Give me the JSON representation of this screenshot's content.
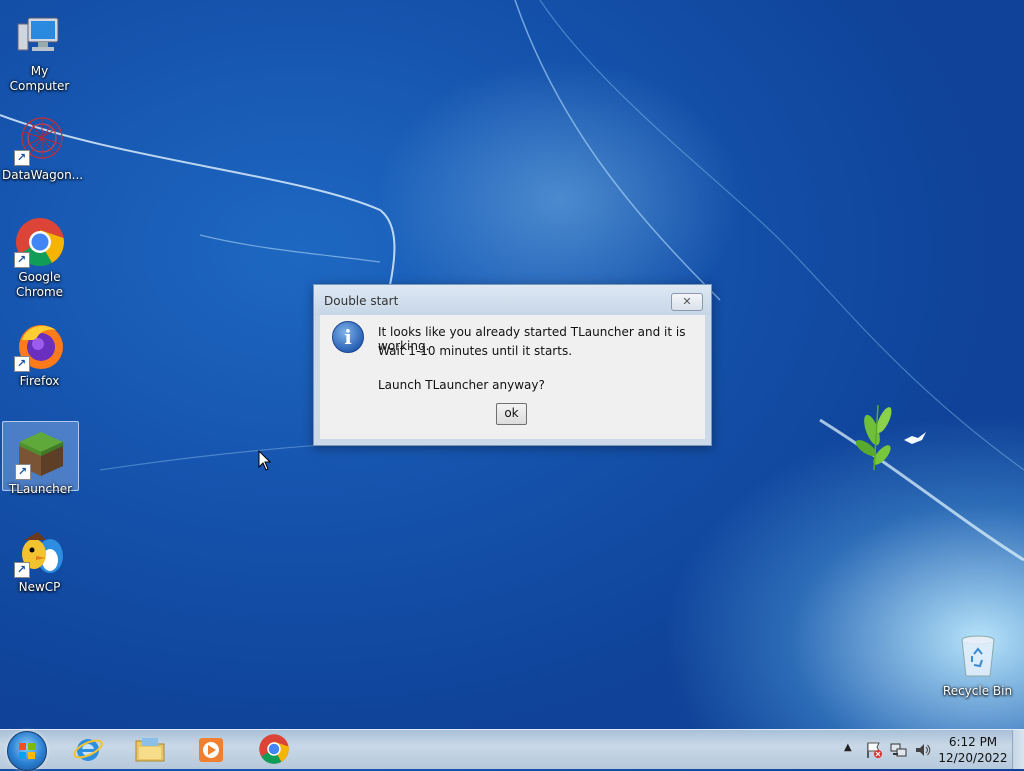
{
  "desktop": {
    "icons": [
      {
        "label": "My Computer",
        "icon": "computer-icon"
      },
      {
        "label": "DataWagon...",
        "icon": "datawagon-icon"
      },
      {
        "label": "Google Chrome",
        "icon": "chrome-icon"
      },
      {
        "label": "Firefox",
        "icon": "firefox-icon"
      },
      {
        "label": "TLauncher",
        "icon": "minecraft-grass-block-icon"
      },
      {
        "label": "NewCP",
        "icon": "newcp-penguin-icon"
      },
      {
        "label": "Recycle Bin",
        "icon": "recycle-bin-icon"
      }
    ]
  },
  "dialog": {
    "title": "Double start",
    "close_glyph": "✕",
    "icon": "info-icon",
    "message_line1": "It looks like you already started TLauncher and it is working.",
    "message_line2": "Wait 1-10 minutes until it starts.",
    "message_line3": "Launch TLauncher anyway?",
    "ok_label": "ok"
  },
  "taskbar": {
    "items": [
      "internet-explorer-icon",
      "file-explorer-icon",
      "media-player-icon",
      "chrome-icon"
    ],
    "tray_icons": [
      "show-hidden-icons-icon",
      "action-center-flag-icon",
      "network-icon",
      "volume-icon"
    ],
    "time": "6:12 PM",
    "date": "12/20/2022"
  },
  "colors": {
    "desktop_blue": "#1553ad",
    "dialog_frame": "#ccd9e8",
    "taskbar": "#c9d8e6"
  }
}
